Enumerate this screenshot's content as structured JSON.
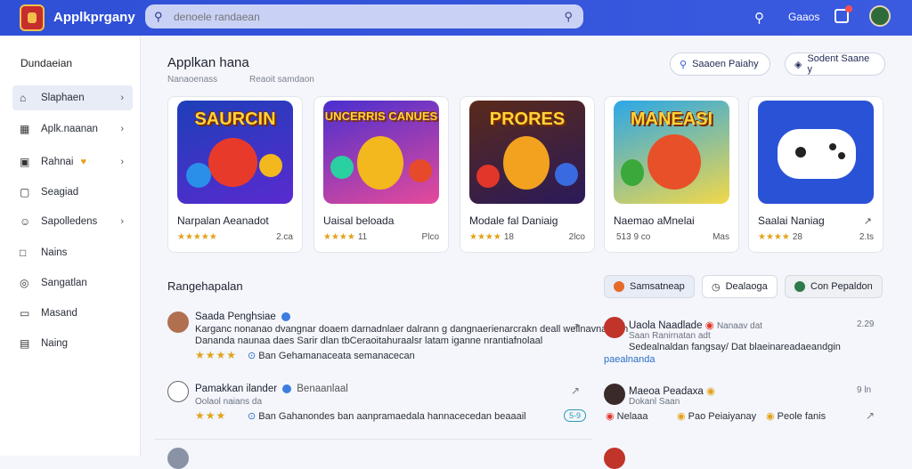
{
  "app": {
    "title": "Applkprgany"
  },
  "header": {
    "search_placeholder": "denoele randaean",
    "user_label": "Gaaos"
  },
  "sidebar": {
    "title": "Dundaeian",
    "items": [
      {
        "label": "Slaphaen",
        "icon": "home-icon",
        "chevron": "›"
      },
      {
        "label": "Aplk.naanan",
        "icon": "grid-icon",
        "chevron": "›"
      },
      {
        "label": "Rahnai",
        "icon": "flag-icon",
        "badge": "♥",
        "chevron": "›"
      },
      {
        "label": "Seagiad",
        "icon": "box-icon"
      },
      {
        "label": "Sapolledens",
        "icon": "user-icon",
        "chevron": "›"
      },
      {
        "label": "Nains",
        "icon": "square-icon"
      },
      {
        "label": "Sangatlan",
        "icon": "circle-icon"
      },
      {
        "label": "Masand",
        "icon": "chat-icon"
      },
      {
        "label": "Naing",
        "icon": "list-icon"
      }
    ]
  },
  "main": {
    "title": "Applkan hana",
    "sub1": "Nanaoenass",
    "sub2": "Reaoit samdaon",
    "btn_primary": "Saaoen Paiahy",
    "btn_secondary": "Sodent Saane y"
  },
  "apps": [
    {
      "art_title": "SAURCIN",
      "name": "Narpalan Aeanadot",
      "stars": "★★★★★",
      "rating": "",
      "size": "2.ca",
      "bg": "#1d3fb8",
      "c1": "#e83a2a",
      "c2": "#2a8fe8"
    },
    {
      "art_title": "UNCERRIS CANUES",
      "name": "Uaisal beloada",
      "stars": "★★★★",
      "rating": "11",
      "size": "Plco",
      "bg": "#4a2fd0",
      "c1": "#f2b81e",
      "c2": "#e64a9a"
    },
    {
      "art_title": "PRORES",
      "name": "Modale fal Daniaig",
      "stars": "★★★★",
      "rating": "18",
      "size": "2lco",
      "bg": "#5a2a1a",
      "c1": "#f2a21e",
      "c2": "#e2362a"
    },
    {
      "art_title": "MANEASI",
      "name": "Naemao aMnelai",
      "stars": "",
      "rating": "513 9 co",
      "size": "Mas",
      "bg": "#2aa7e8",
      "c1": "#e8502a",
      "c2": "#3aa83a"
    },
    {
      "art_title": "",
      "name": "Saalai Naniag",
      "stars": "★★★★",
      "rating": "28",
      "size": "2.ts",
      "bg": "#2a52d6",
      "c1": "#ffffff",
      "c2": "#222"
    }
  ],
  "reviews_section": {
    "title": "Rangehapalan",
    "chips": [
      {
        "label": "Samsatneap",
        "color": "#e86a2a"
      },
      {
        "label": "Dealaoga",
        "color": "#333333"
      },
      {
        "label": "Con Pepaldon",
        "color": "#2f7a4a"
      }
    ]
  },
  "reviews_left": [
    {
      "name": "Saada Penghsiae",
      "line1": "Karganc nonanao dvangnar doaem darnadnlaer dalrann g dangnaerienarcrakn deall wellnavnal bah",
      "line2": "Dananda naunaa daes Sarir dlan tbCeraoitahuraalsr latam iganne nrantiafnolaal",
      "stars": "★★★★",
      "meta": "Ban Gehamanaceata semanacecan",
      "avatar": "#b07050"
    },
    {
      "name": "Pamakkan ilander",
      "tag": "Benaanlaal",
      "line1": "Oolaol naians da",
      "line2": "",
      "stars": "★★★",
      "meta": "Ban Gahanondes ban aanpramaedala hannacecedan beaaail",
      "pill": "5-9",
      "avatar": "#ffffff"
    }
  ],
  "reviews_right": [
    {
      "name": "Uaola Naadlade",
      "time": "Nanaav dat",
      "count": "2.29",
      "line1": "Saan Ranirnatan adt",
      "line2": "Sedealnaldan fangsay/ Dat blaeinareadaeandgin",
      "line3": "paealnanda",
      "avatar": "#c0342a"
    },
    {
      "name": "Maeoa Peadaxa",
      "count": "9 ln",
      "line1": "Dokanl Saan",
      "tags": [
        "Nelaaa",
        "Pao Peiaiyanay",
        "Peole fanis"
      ],
      "avatar": "#3a2a2a"
    }
  ]
}
